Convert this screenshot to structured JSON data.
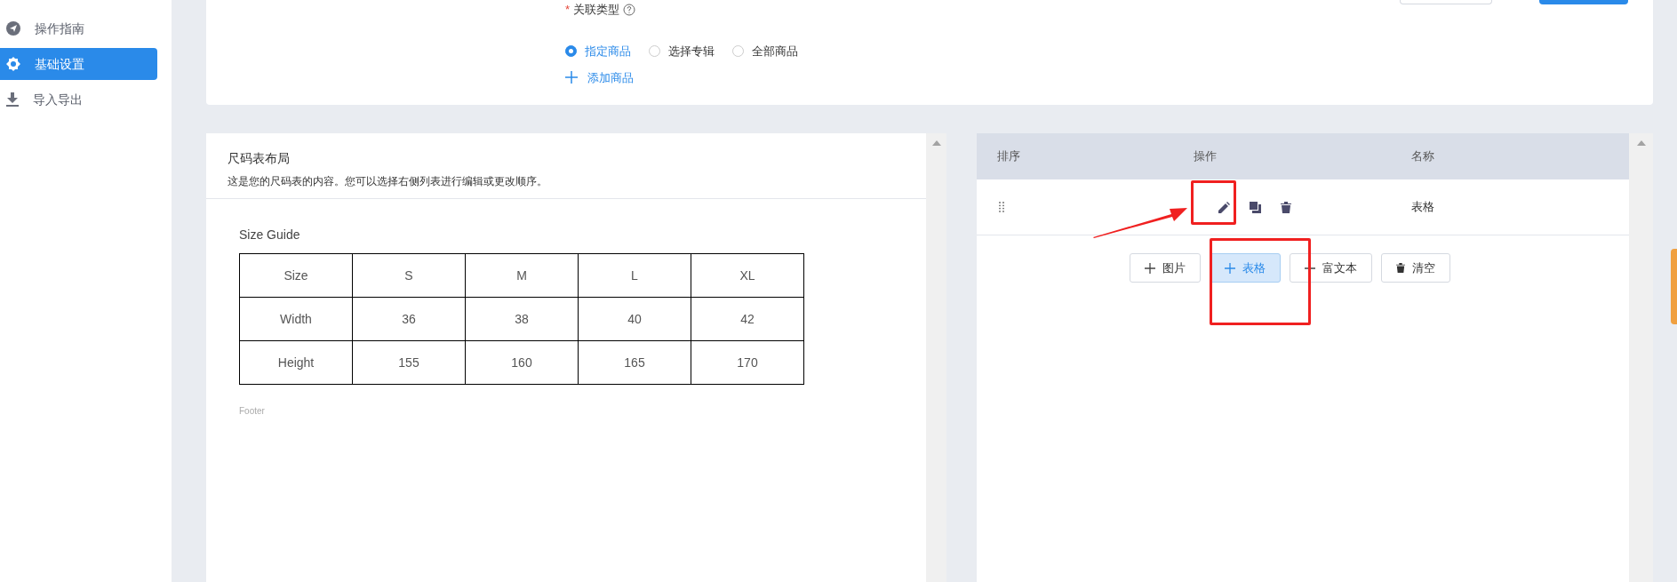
{
  "sidebar": {
    "items": [
      {
        "label": "操作指南",
        "kind": "guide",
        "selected": false
      },
      {
        "label": "基础设置",
        "kind": "settings",
        "selected": true
      },
      {
        "label": "导入导出",
        "kind": "download",
        "selected": false
      }
    ]
  },
  "association": {
    "label": "关联类型",
    "required_mark": "*",
    "options": [
      {
        "label": "指定商品",
        "selected": true
      },
      {
        "label": "选择专辑",
        "selected": false
      },
      {
        "label": "全部商品",
        "selected": false
      }
    ],
    "add_link": "添加商品"
  },
  "layout_panel": {
    "title": "尺码表布局",
    "description": "这是您的尺码表的内容。您可以选择右侧列表进行编辑或更改顺序。",
    "preview": {
      "title": "Size Guide",
      "rows": [
        [
          "Size",
          "S",
          "M",
          "L",
          "XL"
        ],
        [
          "Width",
          "36",
          "38",
          "40",
          "42"
        ],
        [
          "Height",
          "155",
          "160",
          "165",
          "170"
        ]
      ],
      "footer": "Footer"
    }
  },
  "block_list": {
    "columns": [
      "排序",
      "操作",
      "名称"
    ],
    "rows": [
      {
        "name": "表格"
      }
    ],
    "buttons": [
      {
        "label": "图片",
        "kind": "add",
        "selected": false
      },
      {
        "label": "表格",
        "kind": "add",
        "selected": true
      },
      {
        "label": "富文本",
        "kind": "add",
        "selected": false
      },
      {
        "label": "清空",
        "kind": "clear",
        "selected": false
      }
    ]
  }
}
